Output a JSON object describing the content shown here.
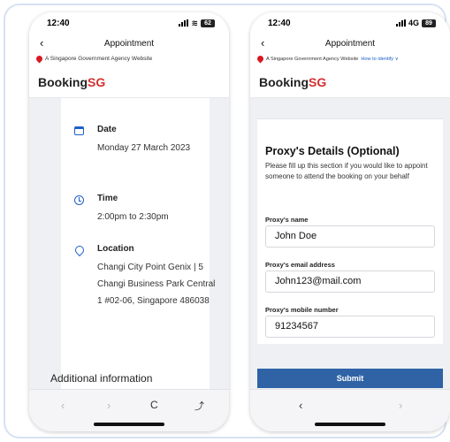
{
  "left_phone": {
    "status": {
      "time": "12:40",
      "battery": "62"
    },
    "nav_title": "Appointment",
    "gov_banner": "A Singapore Government Agency Website",
    "brand": {
      "part1": "Booking",
      "part2": "SG"
    },
    "date": {
      "label": "Date",
      "value": "Monday 27 March 2023"
    },
    "time": {
      "label": "Time",
      "value": "2:00pm to 2:30pm"
    },
    "location": {
      "label": "Location",
      "value": "Changi City Point Genix | 5 Changi Business Park Central 1 #02-06, Singapore 486038"
    },
    "additional_heading": "Additional information",
    "toolbar": {
      "back": "‹",
      "forward": "›",
      "reload": "C",
      "share": "⤴"
    }
  },
  "right_phone": {
    "status": {
      "time": "12:40",
      "network": "4G",
      "battery": "89"
    },
    "nav_title": "Appointment",
    "gov_banner": "A Singapore Government Agency Website",
    "gov_link": "How to identify ∨",
    "brand": {
      "part1": "Booking",
      "part2": "SG"
    },
    "proxy": {
      "title": "Proxy's Details (Optional)",
      "description": "Please fill up this section if you would like to appoint someone to attend the booking on your behalf",
      "name_label": "Proxy's name",
      "name_value": "John Doe",
      "email_label": "Proxy's email address",
      "email_value": "John123@mail.com",
      "mobile_label": "Proxy's mobile number",
      "mobile_value": "91234567"
    },
    "submit_label": "Submit",
    "toolbar": {
      "back": "‹",
      "forward": "›"
    }
  }
}
